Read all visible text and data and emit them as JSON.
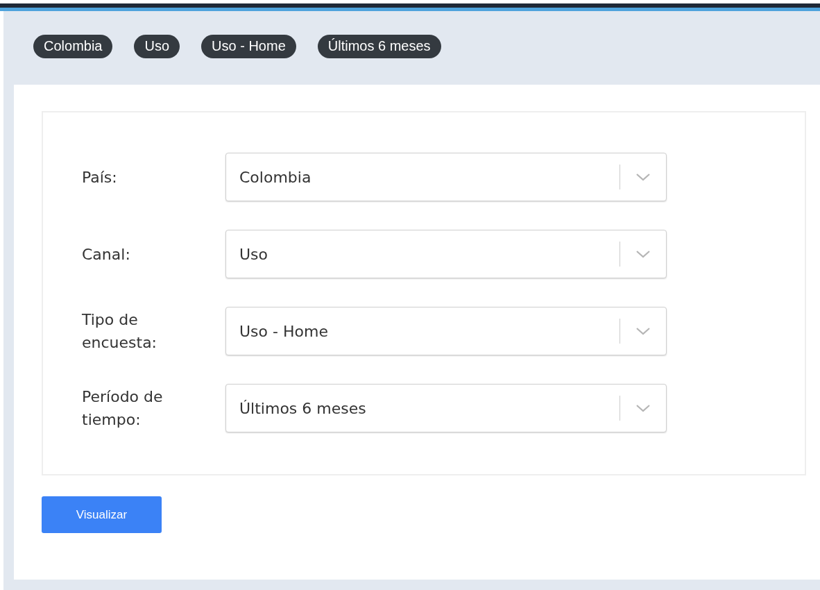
{
  "filter_chips": [
    {
      "label": "Colombia"
    },
    {
      "label": "Uso"
    },
    {
      "label": "Uso - Home"
    },
    {
      "label": "Últimos 6 meses"
    }
  ],
  "form": {
    "fields": [
      {
        "label": "País:",
        "value": "Colombia"
      },
      {
        "label": "Canal:",
        "value": "Uso"
      },
      {
        "label": "Tipo de encuesta:",
        "value": "Uso - Home"
      },
      {
        "label": "Período de tiempo:",
        "value": "Últimos 6 meses"
      }
    ]
  },
  "submit_button": {
    "label": "Visualizar"
  }
}
